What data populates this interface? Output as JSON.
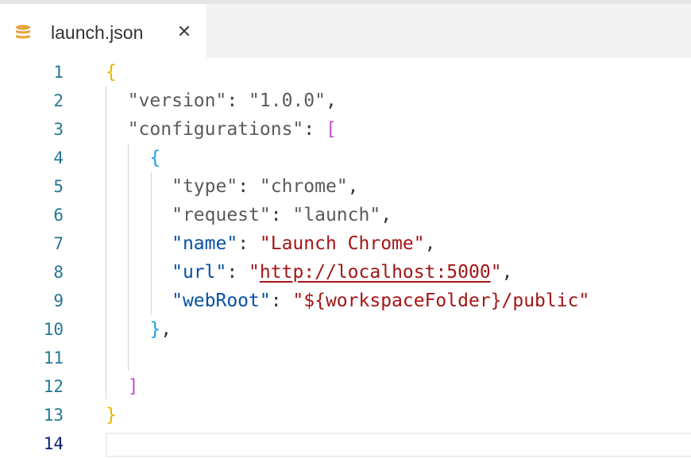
{
  "tab": {
    "filename": "launch.json",
    "close_glyph": "✕",
    "icon": "database-icon",
    "icon_color": "#e8a43d"
  },
  "editor": {
    "active_line": 14,
    "colors": {
      "key": "#0451a5",
      "string_value": "#a31515",
      "line_number": "#237893",
      "bracket_level1": "#e2b800",
      "bracket_level2": "#c74fc7",
      "bracket_level3": "#1e9fe6"
    },
    "lines": [
      {
        "n": "1",
        "tokens": [
          {
            "t": "{",
            "c": "br1"
          }
        ]
      },
      {
        "n": "2",
        "tokens": [
          {
            "t": "  "
          },
          {
            "t": "\"version\"",
            "c": "tk-key-plain"
          },
          {
            "t": ": "
          },
          {
            "t": "\"1.0.0\"",
            "c": "tk-str"
          },
          {
            "t": ","
          }
        ]
      },
      {
        "n": "3",
        "tokens": [
          {
            "t": "  "
          },
          {
            "t": "\"configurations\"",
            "c": "tk-key-plain"
          },
          {
            "t": ": "
          },
          {
            "t": "[",
            "c": "br2"
          }
        ]
      },
      {
        "n": "4",
        "tokens": [
          {
            "t": "    "
          },
          {
            "t": "{",
            "c": "br3"
          }
        ]
      },
      {
        "n": "5",
        "tokens": [
          {
            "t": "      "
          },
          {
            "t": "\"type\"",
            "c": "tk-key-plain"
          },
          {
            "t": ": "
          },
          {
            "t": "\"chrome\"",
            "c": "tk-str"
          },
          {
            "t": ","
          }
        ]
      },
      {
        "n": "6",
        "tokens": [
          {
            "t": "      "
          },
          {
            "t": "\"request\"",
            "c": "tk-key-plain"
          },
          {
            "t": ": "
          },
          {
            "t": "\"launch\"",
            "c": "tk-str"
          },
          {
            "t": ","
          }
        ]
      },
      {
        "n": "7",
        "tokens": [
          {
            "t": "      "
          },
          {
            "t": "\"name\"",
            "c": "tk-key"
          },
          {
            "t": ": "
          },
          {
            "t": "\"Launch Chrome\"",
            "c": "tk-val"
          },
          {
            "t": ","
          }
        ]
      },
      {
        "n": "8",
        "tokens": [
          {
            "t": "      "
          },
          {
            "t": "\"url\"",
            "c": "tk-key"
          },
          {
            "t": ": "
          },
          {
            "t": "\"",
            "c": "tk-val"
          },
          {
            "t": "http://localhost:5000",
            "c": "tk-url"
          },
          {
            "t": "\"",
            "c": "tk-val"
          },
          {
            "t": ","
          }
        ]
      },
      {
        "n": "9",
        "tokens": [
          {
            "t": "      "
          },
          {
            "t": "\"webRoot\"",
            "c": "tk-key"
          },
          {
            "t": ": "
          },
          {
            "t": "\"${workspaceFolder}/public\"",
            "c": "tk-val"
          }
        ]
      },
      {
        "n": "10",
        "tokens": [
          {
            "t": "    "
          },
          {
            "t": "}",
            "c": "br3"
          },
          {
            "t": ","
          }
        ]
      },
      {
        "n": "11",
        "tokens": []
      },
      {
        "n": "12",
        "tokens": [
          {
            "t": "  "
          },
          {
            "t": "]",
            "c": "br2"
          }
        ]
      },
      {
        "n": "13",
        "tokens": [
          {
            "t": "}",
            "c": "br1"
          }
        ]
      },
      {
        "n": "14",
        "tokens": []
      }
    ]
  }
}
